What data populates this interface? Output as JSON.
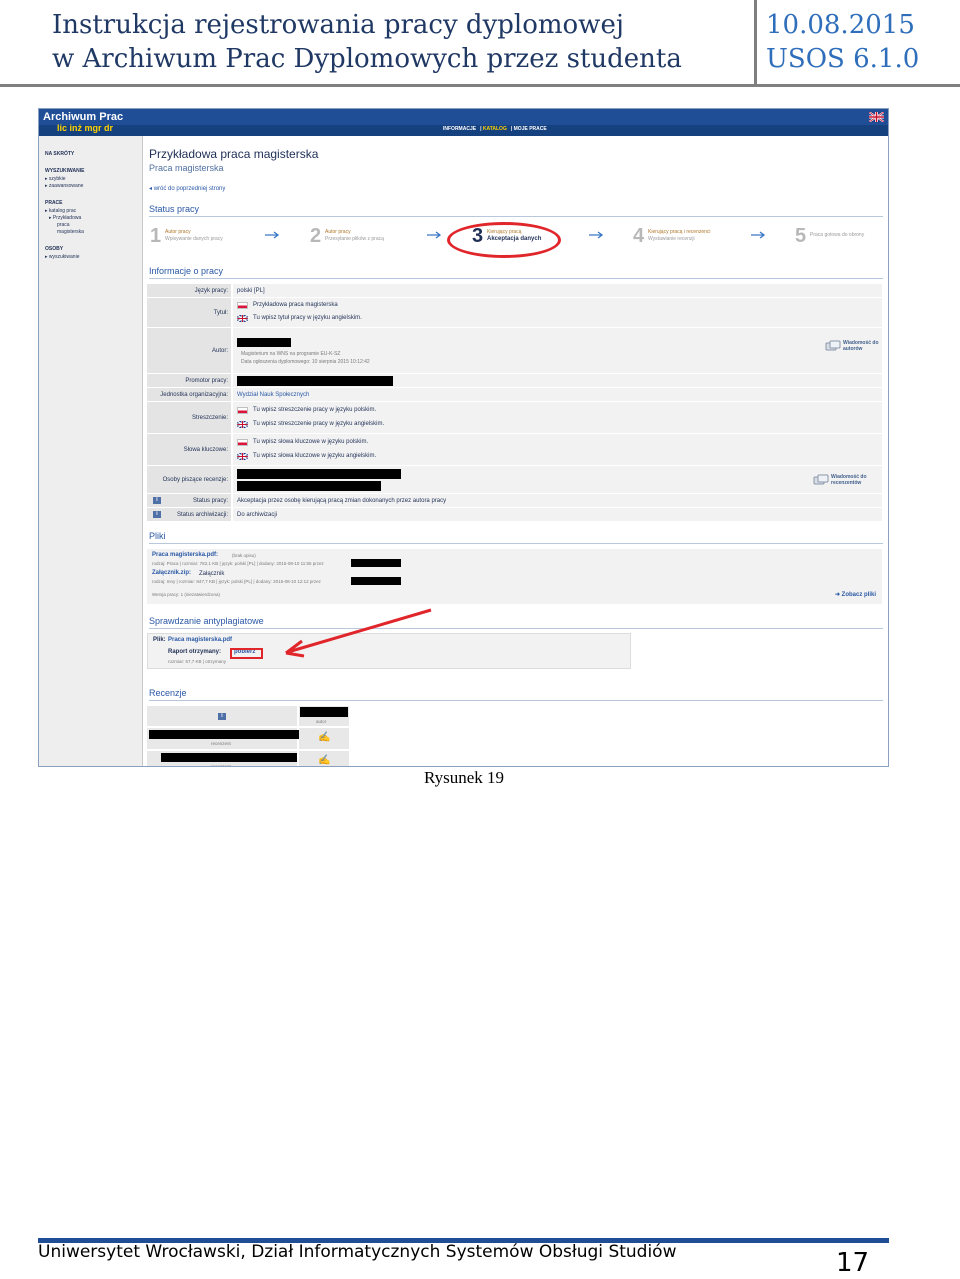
{
  "header": {
    "title_line1": "Instrukcja rejestrowania pracy dyplomowej",
    "title_line2": "w Archiwum Prac Dyplomowych przez studenta",
    "date": "10.08.2015",
    "version": "USOS 6.1.0"
  },
  "app": {
    "brand": "Archiwum Prac",
    "brand_sub": "lic inż mgr dr",
    "nav": [
      "INFORMACJE",
      "KATALOG",
      "MOJE PRACE"
    ],
    "nav_active": "KATALOG"
  },
  "sidebar": {
    "items": [
      "NA SKRÓTY",
      "WYSZUKIWANIE",
      "szybkie",
      "zaawansowane",
      "PRACE",
      "katalog prac",
      "Przykładowa",
      "praca",
      "magisterska",
      "OSOBY",
      "wyszukiwanie"
    ]
  },
  "page": {
    "title": "Przykładowa praca magisterska",
    "subtitle": "Praca magisterska",
    "back_link": "wróć do poprzedniej strony",
    "status_section": "Status pracy",
    "info_section": "Informacje o pracy",
    "files_section": "Pliki",
    "antiplag_section": "Sprawdzanie antyplagiatowe",
    "reviews_section": "Recenzje"
  },
  "steps": [
    {
      "num": "1",
      "line1": "Autor pracy",
      "line2": "Wpisywanie danych pracy"
    },
    {
      "num": "2",
      "line1": "Autor pracy",
      "line2": "Przesyłanie plików z pracą"
    },
    {
      "num": "3",
      "line1": "Kierujący pracą",
      "line2": "Akceptacja danych"
    },
    {
      "num": "4",
      "line1": "Kierujący pracą i recenzenci",
      "line2": "Wystawianie recenzji"
    },
    {
      "num": "5",
      "line1": "",
      "line2": "Praca gotowa do obrony"
    }
  ],
  "info_rows": {
    "language_label": "Język pracy:",
    "language_value": "polski [PL]",
    "title_label": "Tytuł:",
    "title_pl": "Przykładowa praca magisterska",
    "title_en": "Tu wpisz tytuł pracy w języku angielskim.",
    "author_label": "Autor:",
    "author_line1": "Magisterium na WNS na programie EU-K-SZ",
    "author_line2": "Data ogłoszenia dyplomowego: 10 sierpnia 2015 10:12:42",
    "author_msg": "Wiadomość do autorów",
    "promoter_label": "Promotor pracy:",
    "unit_label": "Jednostka organizacyjna:",
    "unit_value": "Wydział Nauk Społecznych",
    "abstract_label": "Streszczenie:",
    "abstract_pl": "Tu wpisz streszczenie pracy w języku polskim.",
    "abstract_en": "Tu wpisz streszczenie pracy w języku angielskim.",
    "keywords_label": "Słowa kluczowe:",
    "keywords_pl": "Tu wpisz słowa kluczowe w języku polskim.",
    "keywords_en": "Tu wpisz słowa kluczowe w języku angielskim.",
    "reviewers_label": "Osoby piszące recenzje:",
    "reviewers_msg": "Wiadomość do recenzentów",
    "status_label": "Status pracy:",
    "status_value": "Akceptacja przez osobę kierującą pracą zmian dokonanych przez autora pracy",
    "archive_label": "Status archiwizacji:",
    "archive_value": "Do archiwizacji"
  },
  "files": {
    "file1_name": "Praca magisterska.pdf:",
    "file1_desc": "(brak opisu)",
    "file1_meta": "rodzaj: Praca | rozmiar: 782,1 KB | język: polski [PL] | dodany: 2015-08-10 11:55 przez",
    "file2_name": "Załącznik.zip:",
    "file2_desc": "Załącznik",
    "file2_meta": "rodzaj: Inny | rozmiar: 847,7 KB | język: polski [PL] | dodany: 2015-08-10 12:12 przez",
    "version": "Wersja pracy: 1 (niezatwierdzona)",
    "see_files": "Zobacz pliki"
  },
  "antiplag": {
    "file_label": "Plik:",
    "file_name": "Praca magisterska.pdf",
    "report_label": "Raport otrzymany:",
    "download": "pobierz",
    "meta": "rozmiar: 57,7 KB | otrzymany"
  },
  "reviews": {
    "col_header": "autor",
    "role1": "recenzent",
    "role2": "recenzent"
  },
  "caption": "Rysunek 19",
  "footer": {
    "org": "Uniwersytet Wrocławski, Dział Informatycznych Systemów Obsługi Studiów",
    "page": "17"
  }
}
